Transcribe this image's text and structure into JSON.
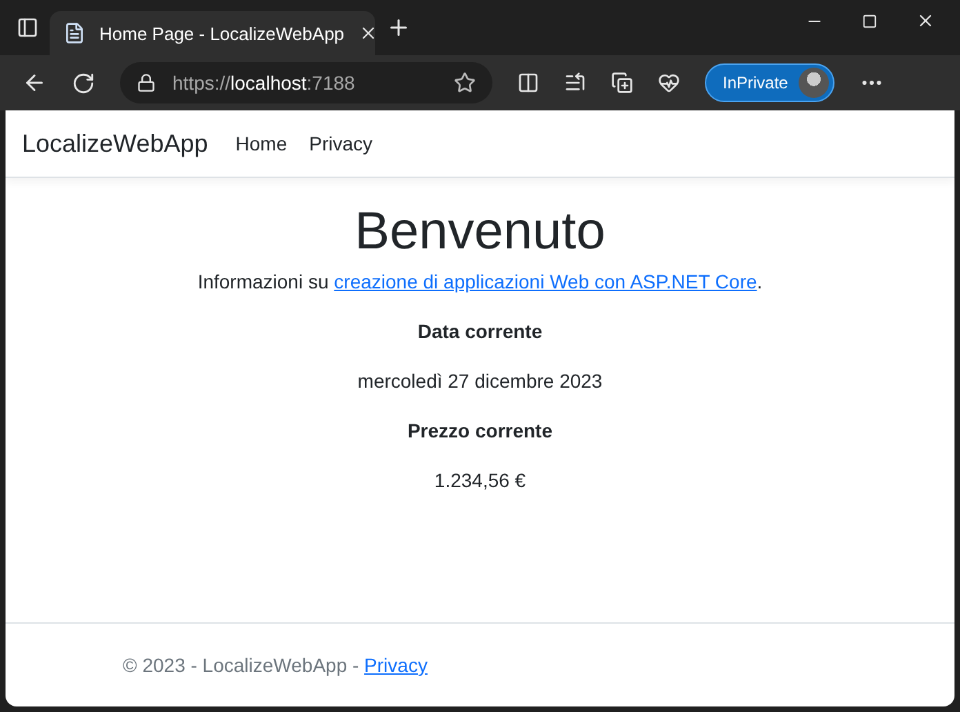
{
  "browser": {
    "tab_title": "Home Page - LocalizeWebApp",
    "url": {
      "scheme": "https://",
      "host": "localhost",
      "port": ":7188"
    },
    "profile_label": "InPrivate"
  },
  "navbar": {
    "brand": "LocalizeWebApp",
    "links": [
      "Home",
      "Privacy"
    ]
  },
  "main": {
    "heading": "Benvenuto",
    "intro_before": "Informazioni su ",
    "intro_link": "creazione di applicazioni Web con ASP.NET Core",
    "intro_after": ".",
    "sections": [
      {
        "label": "Data corrente",
        "value": "mercoledì 27 dicembre 2023"
      },
      {
        "label": "Prezzo corrente",
        "value": "1.234,56 €"
      }
    ]
  },
  "footer": {
    "text": "© 2023 - LocalizeWebApp - ",
    "link": "Privacy"
  }
}
